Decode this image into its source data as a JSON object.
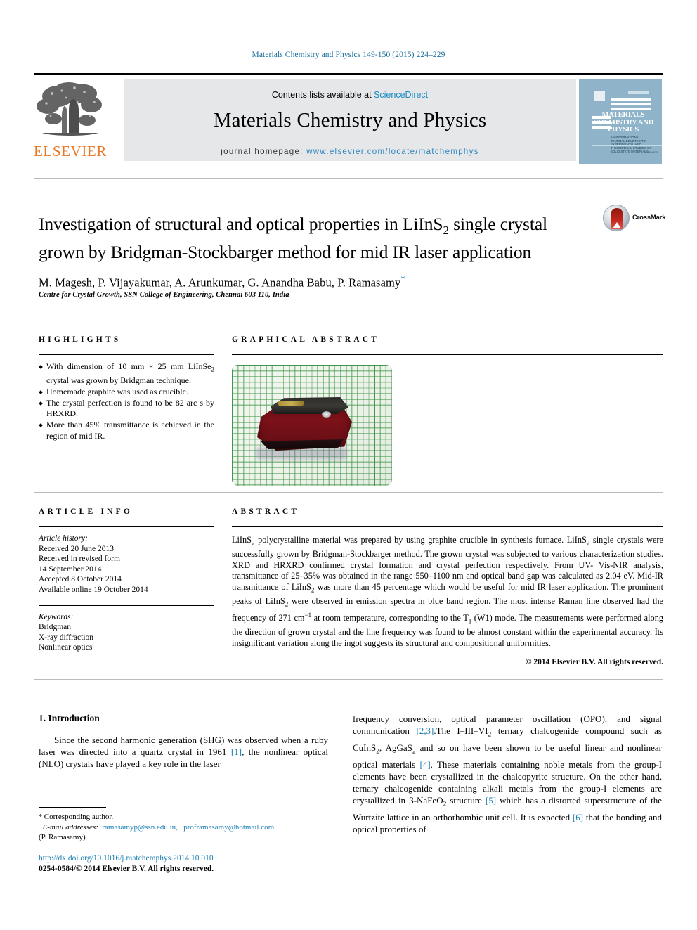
{
  "running_head": "Materials Chemistry and Physics 149-150 (2015) 224–229",
  "masthead": {
    "contents_prefix": "Contents lists available at ",
    "sciencedirect": "ScienceDirect",
    "journal_name": "Materials Chemistry and Physics",
    "homepage_label": "journal homepage: ",
    "homepage_url": "www.elsevier.com/locate/matchemphys",
    "publisher_logo_text": "ELSEVIER",
    "cover": {
      "line1": "MATERIALS",
      "line2": "CHEMISTRY AND",
      "line3": "PHYSICS",
      "subtitle": "AN INTERNATIONAL JOURNAL DEVOTED TO EXPERIMENTAL AND THEORETICAL STUDIES OF SOLID STATE MATERIALS",
      "footer": "ELSEVIER"
    }
  },
  "article": {
    "title_part1": "Investigation of structural and optical properties in LiInS",
    "title_sub": "2",
    "title_part2": " single crystal grown by Bridgman-Stockbarger method for mid IR laser application",
    "authors": "M. Magesh, P. Vijayakumar, A. Arunkumar, G. Anandha Babu, P. Ramasamy",
    "corresponding_marker": "*",
    "affiliation": "Centre for Crystal Growth, SSN College of Engineering, Chennai 603 110, India",
    "crossmark_label": "CrossMark"
  },
  "highlights": {
    "heading": "HIGHLIGHTS",
    "items": [
      "With dimension of 10 mm × 25 mm LiInSe2 crystal was grown by Bridgman technique.",
      "Homemade graphite was used as crucible.",
      "The crystal perfection is found to be 82 arc s by HRXRD.",
      "More than 45% transmittance is achieved in the region of mid IR."
    ]
  },
  "graphical_abstract": {
    "heading": "GRAPHICAL ABSTRACT",
    "image_description": "Photograph of a dark red LiInS2 single crystal ingot slice resting on green millimetre graph paper"
  },
  "article_info": {
    "heading": "ARTICLE INFO",
    "history_label": "Article history:",
    "history": [
      "Received 20 June 2013",
      "Received in revised form",
      "14 September 2014",
      "Accepted 8 October 2014",
      "Available online 19 October 2014"
    ],
    "keywords_label": "Keywords:",
    "keywords": [
      "Bridgman",
      "X-ray diffraction",
      "Nonlinear optics"
    ]
  },
  "abstract": {
    "heading": "ABSTRACT",
    "text": "LiInS2 polycrystalline material was prepared by using graphite crucible in synthesis furnace. LiInS2 single crystals were successfully grown by Bridgman-Stockbarger method. The grown crystal was subjected to various characterization studies. XRD and HRXRD confirmed crystal formation and crystal perfection respectively. From UV- Vis-NIR analysis, transmittance of 25–35% was obtained in the range 550–1100 nm and optical band gap was calculated as 2.04 eV. Mid-IR transmittance of LiInS2 was more than 45 percentage which would be useful for mid IR laser application. The prominent peaks of LiInS2 were observed in emission spectra in blue band region. The most intense Raman line observed had the frequency of 271 cm−1 at room temperature, corresponding to the T1 (W1) mode. The measurements were performed along the direction of grown crystal and the line frequency was found to be almost constant within the experimental accuracy. Its insignificant variation along the ingot suggests its structural and compositional uniformities.",
    "copyright": "© 2014 Elsevier B.V. All rights reserved."
  },
  "introduction": {
    "number_and_title": "1. Introduction",
    "left_paragraph": "Since the second harmonic generation (SHG) was observed when a ruby laser was directed into a quartz crystal in 1961 [1], the nonlinear optical (NLO) crystals have played a key role in the laser",
    "right_paragraph": "frequency conversion, optical parameter oscillation (OPO), and signal communication [2,3].The I–III–VI2 ternary chalcogenide compound such as CuInS2, AgGaS2 and so on have been shown to be useful linear and nonlinear optical materials [4]. These materials containing noble metals from the group-I elements have been crystallized in the chalcopyrite structure. On the other hand, ternary chalcogenide containing alkali metals from the group-I elements are crystallized in β-NaFeO2 structure [5] which has a distorted superstructure of the Wurtzite lattice in an orthorhombic unit cell. It is expected [6] that the bonding and optical properties of"
  },
  "footnote": {
    "star": "*",
    "corresponding": "Corresponding author.",
    "email_label": "E-mail addresses:",
    "email1": "ramasamyp@ssn.edu.in,",
    "email2": "proframasamy@hotmail.com",
    "email_owner": "(P. Ramasamy)."
  },
  "footer": {
    "doi": "http://dx.doi.org/10.1016/j.matchemphys.2014.10.010",
    "issn_copyright": "0254-0584/© 2014 Elsevier B.V. All rights reserved."
  },
  "colors": {
    "link_blue": "#1a7fb5",
    "sciencedirect_blue": "#1a8bc4",
    "elsevier_orange": "#e87722",
    "masthead_gray": "#e6e7e8",
    "cover_blue": "#8fb4c9"
  }
}
